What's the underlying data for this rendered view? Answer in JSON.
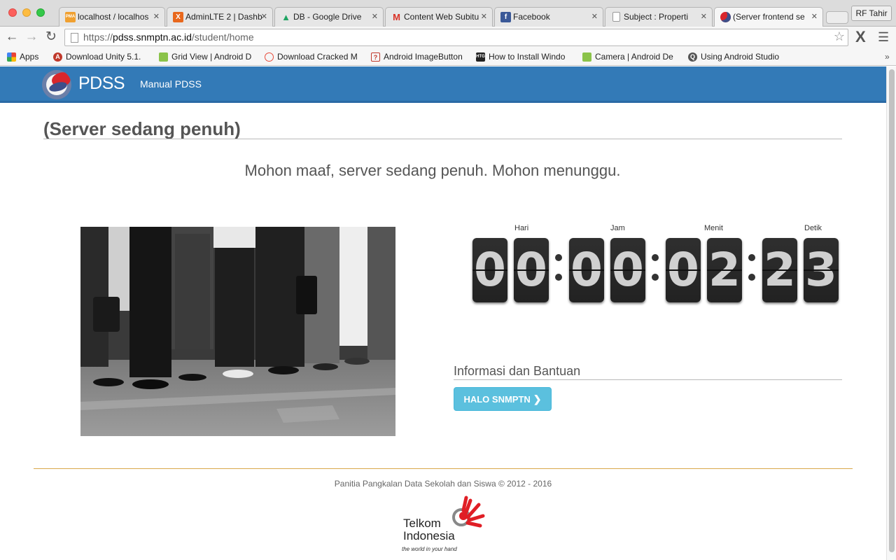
{
  "browser": {
    "tabs": [
      {
        "title": "localhost / localhos",
        "icon": "phpmyadmin-icon",
        "color": "#f0a030",
        "glyph": "PMA"
      },
      {
        "title": "AdminLTE 2 | Dashb",
        "icon": "xampp-icon",
        "color": "#e8671c",
        "glyph": "X"
      },
      {
        "title": "DB - Google Drive",
        "icon": "google-drive-icon",
        "color": "#1fa463",
        "glyph": "▲"
      },
      {
        "title": "Content Web Subitu",
        "icon": "gmail-icon",
        "color": "#d93025",
        "glyph": "M"
      },
      {
        "title": "Facebook",
        "icon": "facebook-icon",
        "color": "#3b5998",
        "glyph": "f"
      },
      {
        "title": "Subject : Properti",
        "icon": "document-icon",
        "color": "#9a9a9a",
        "glyph": "▢"
      },
      {
        "title": "(Server frontend se",
        "icon": "pdss-icon",
        "color": "#3d4f8a",
        "glyph": "◐"
      }
    ],
    "profile_label": "RF Tahir",
    "url_prefix": "https://",
    "url_host": "pdss.snmptn.ac.id",
    "url_path": "/student/home",
    "bookmarks": [
      {
        "label": "Apps",
        "icon": "apps-grid-icon",
        "color": "#4285f4",
        "glyph": "⋮"
      },
      {
        "label": "Download Unity 5.1.",
        "icon": "unity-icon",
        "color": "#c0392b",
        "glyph": "A"
      },
      {
        "label": "Grid View | Android D",
        "icon": "android-icon",
        "color": "#8bc34a",
        "glyph": "▲"
      },
      {
        "label": "Download Cracked M",
        "icon": "apple-icon",
        "color": "#e74c3c",
        "glyph": "●"
      },
      {
        "label": "Android ImageButton",
        "icon": "question-icon",
        "color": "#c0392b",
        "glyph": "?"
      },
      {
        "label": "How to Install Windo",
        "icon": "htg-icon",
        "color": "#222222",
        "glyph": "H"
      },
      {
        "label": "Camera | Android De",
        "icon": "android-icon",
        "color": "#8bc34a",
        "glyph": "▲"
      },
      {
        "label": "Using Android Studio",
        "icon": "android-studio-icon",
        "color": "#555555",
        "glyph": "Q"
      }
    ],
    "bookmarks_more": "»"
  },
  "navbar": {
    "brand": "PDSS",
    "link": "Manual PDSS",
    "color": "#337ab7"
  },
  "main": {
    "title": "(Server sedang penuh)",
    "message": "Mohon maaf, server sedang penuh. Mohon menunggu.",
    "photo_alt": "crowd-queue-photo"
  },
  "countdown": {
    "labels": {
      "days": "Hari",
      "hours": "Jam",
      "minutes": "Menit",
      "seconds": "Detik"
    },
    "digits": {
      "days": [
        "0",
        "0"
      ],
      "hours": [
        "0",
        "0"
      ],
      "minutes": [
        "0",
        "2"
      ],
      "seconds": [
        "2",
        "3"
      ]
    }
  },
  "info": {
    "title": "Informasi dan Bantuan",
    "button_label": "HALO SNMPTN",
    "button_color": "#5bc0de"
  },
  "footer": {
    "copyright": "Panitia Pangkalan Data Sekolah dan Siswa © 2012 - 2016",
    "logo_name_line1": "Telkom",
    "logo_name_line2": "Indonesia",
    "logo_tagline": "the world in your hand"
  }
}
